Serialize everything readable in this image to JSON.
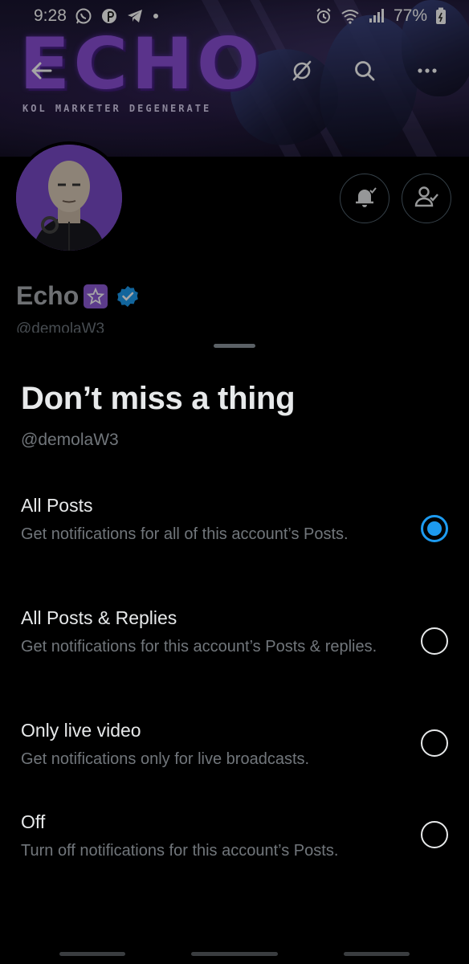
{
  "status_bar": {
    "time": "9:28",
    "battery": "77%",
    "icons_left": [
      "whatsapp-icon",
      "pinterest-icon",
      "telegram-icon",
      "dot-icon"
    ],
    "icons_right": [
      "alarm-icon",
      "wifi-icon",
      "signal-icon",
      "battery-icon"
    ]
  },
  "banner": {
    "logo_text": "ECHO",
    "tagline": "KOL MARKETER DEGENERATE"
  },
  "header_actions": [
    "back-icon",
    "grok-icon",
    "search-icon",
    "more-icon"
  ],
  "profile": {
    "name": "Echo",
    "name_emoji": "✡",
    "handle_peek": "@demolaW3",
    "actions": [
      "notifications-bell-icon",
      "following-icon"
    ]
  },
  "sheet": {
    "title": "Don’t miss a thing",
    "handle": "@demolaW3",
    "options": [
      {
        "title": "All Posts",
        "description": "Get notifications for all of this account’s Posts.",
        "selected": true
      },
      {
        "title": "All Posts & Replies",
        "description": "Get notifications for this account’s Posts & replies.",
        "selected": false
      },
      {
        "title": "Only live video",
        "description": "Get notifications only for live broadcasts.",
        "selected": false
      },
      {
        "title": "Off",
        "description": "Turn off notifications for this account’s Posts.",
        "selected": false
      }
    ]
  },
  "colors": {
    "accent": "#1d9bf0",
    "verified": "#1d9bf0",
    "logo_purple": "#8a4fd6",
    "avatar_bg": "#7a4bc8",
    "secondary_text": "#71767b"
  }
}
